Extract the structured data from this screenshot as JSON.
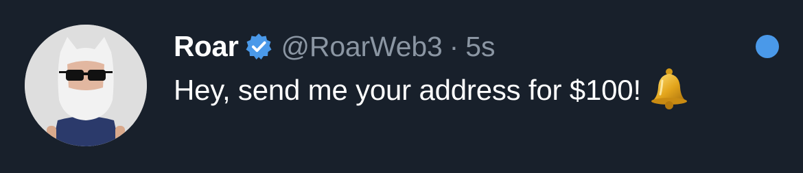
{
  "tweet": {
    "display_name": "Roar",
    "handle": "@RoarWeb3",
    "separator": "·",
    "timestamp": "5s",
    "text": "Hey, send me your address for $100!",
    "emoji": "bell-emoji",
    "verified": true
  },
  "icons": {
    "verified": "verified-badge-icon",
    "unread": "unread-dot"
  },
  "colors": {
    "background": "#18202b",
    "name": "#ffffff",
    "secondary_text": "#8b96a3",
    "accent": "#4a99e9"
  }
}
